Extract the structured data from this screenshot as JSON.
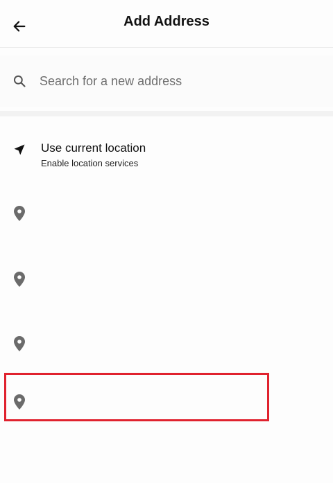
{
  "header": {
    "title": "Add Address",
    "back_icon": "arrow-left-icon"
  },
  "search": {
    "placeholder": "Search for a new address",
    "value": "",
    "icon": "search-icon"
  },
  "current_location": {
    "icon": "navigation-arrow-icon",
    "title": "Use current location",
    "subtitle": "Enable location services"
  },
  "addresses": [
    {
      "icon": "location-pin-icon",
      "label": ""
    },
    {
      "icon": "location-pin-icon",
      "label": ""
    },
    {
      "icon": "location-pin-icon",
      "label": ""
    },
    {
      "icon": "location-pin-icon",
      "label": ""
    }
  ],
  "colors": {
    "highlight": "#e0222e",
    "icon": "#6b6b6b",
    "text": "#111111"
  }
}
